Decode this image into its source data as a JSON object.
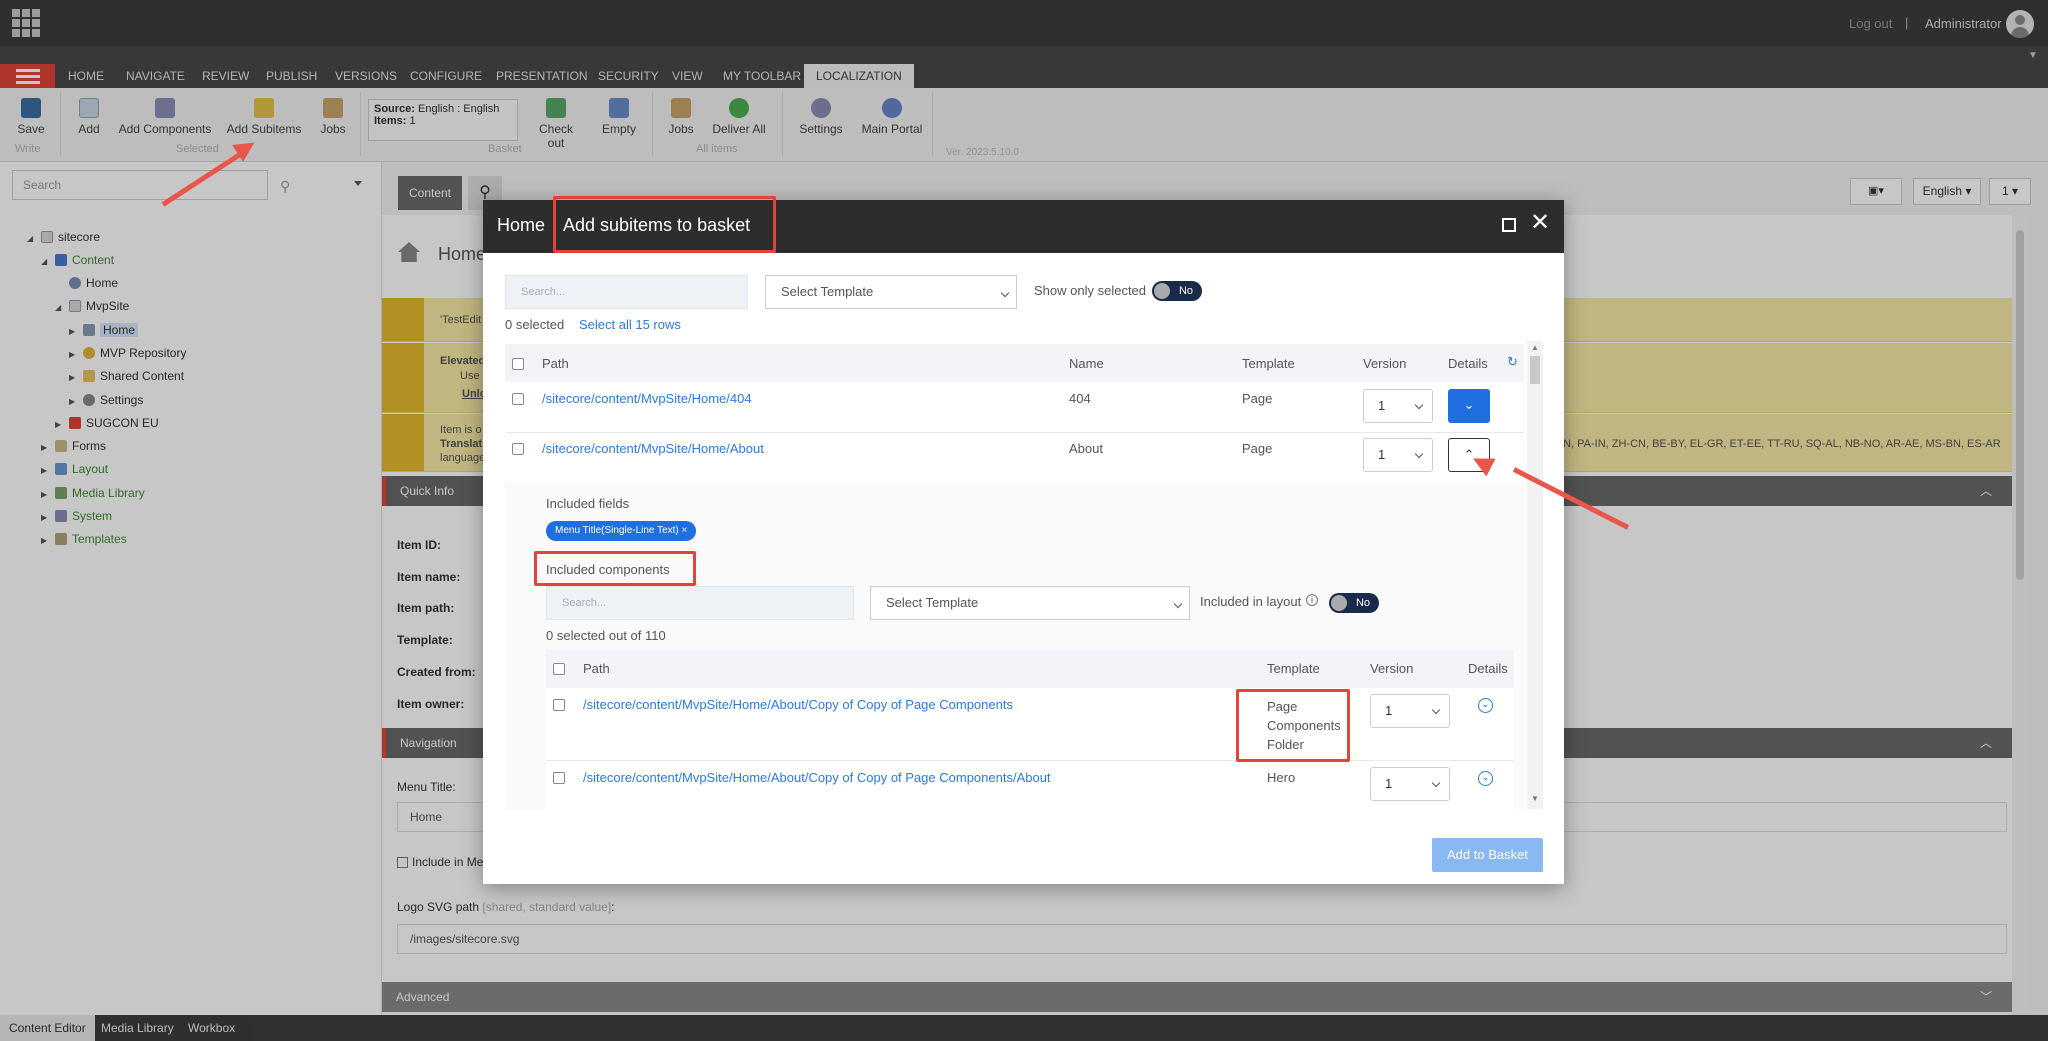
{
  "topbar": {
    "logout": "Log out",
    "separator": "|",
    "user": "Administrator"
  },
  "tabs": [
    "HOME",
    "NAVIGATE",
    "REVIEW",
    "PUBLISH",
    "VERSIONS",
    "CONFIGURE",
    "PRESENTATION",
    "SECURITY",
    "VIEW",
    "MY TOOLBAR",
    "LOCALIZATION"
  ],
  "ribbon": {
    "save": "Save",
    "add": "Add",
    "add_components": "Add Components",
    "add_subitems": "Add Subitems",
    "jobs1": "Jobs",
    "source_label": "Source:",
    "source_value": "English : English",
    "items_label": "Items:",
    "items_value": "1",
    "check_out": "Check out",
    "empty": "Empty",
    "jobs2": "Jobs",
    "deliver_all": "Deliver All",
    "settings": "Settings",
    "main_portal": "Main Portal",
    "group_write": "Write",
    "group_selected": "Selected",
    "group_basket": "Basket",
    "group_all": "All items",
    "version": "Ver. 2023.5.10.0"
  },
  "left": {
    "search_placeholder": "Search",
    "tree": [
      {
        "label": "sitecore",
        "green": false
      },
      {
        "label": "Content",
        "green": true
      },
      {
        "label": "Home",
        "green": false
      },
      {
        "label": "MvpSite",
        "green": false
      },
      {
        "label": "Home",
        "green": false
      },
      {
        "label": "MVP Repository",
        "green": false
      },
      {
        "label": "Shared Content",
        "green": false
      },
      {
        "label": "Settings",
        "green": false
      },
      {
        "label": "SUGCON EU",
        "green": false
      },
      {
        "label": "Forms",
        "green": false
      },
      {
        "label": "Layout",
        "green": true
      },
      {
        "label": "Media Library",
        "green": true
      },
      {
        "label": "System",
        "green": true
      },
      {
        "label": "Templates",
        "green": true
      }
    ]
  },
  "editor": {
    "content_tab": "Content",
    "language": "English",
    "version": "1",
    "page_title": "Home",
    "warn1": "'TestEdit",
    "warn2_title": "Elevated",
    "warn2_line": "Use",
    "warn2_link": "Unlo",
    "warn3_line1": "Item is o",
    "warn3_line2": "Translat",
    "warn3_line3": "language",
    "warn3_langs": "IN, PA-IN, ZH-CN, BE-BY, EL-GR, ET-EE, TT-RU, SQ-AL, NB-NO, AR-AE, MS-BN, ES-AR",
    "quick_info": "Quick Info",
    "labels": [
      "Item ID:",
      "Item name:",
      "Item path:",
      "Template:",
      "Created from:",
      "Item owner:"
    ],
    "navigation": "Navigation",
    "menu_title_label": "Menu Title:",
    "menu_title_value": "Home",
    "include_in_menu": "Include in Men",
    "logo_label": "Logo SVG path",
    "logo_meta": "[shared, standard value]",
    "logo_colon": ":",
    "logo_value": "/images/sitecore.svg",
    "advanced": "Advanced"
  },
  "bottom": [
    "Content Editor",
    "Media Library",
    "Workbox"
  ],
  "modal": {
    "title_home": "Home",
    "title": "Add subitems to basket",
    "search_placeholder": "Search...",
    "template_select": "Select Template",
    "show_only_selected": "Show only selected",
    "toggle_no": "No",
    "selected_count": "0 selected",
    "select_all": "Select all 15 rows",
    "columns": {
      "path": "Path",
      "name": "Name",
      "template": "Template",
      "version": "Version",
      "details": "Details"
    },
    "rows": [
      {
        "path": "/sitecore/content/MvpSite/Home/404",
        "name": "404",
        "template": "Page",
        "version": "1"
      },
      {
        "path": "/sitecore/content/MvpSite/Home/About",
        "name": "About",
        "template": "Page",
        "version": "1"
      }
    ],
    "included_fields": "Included fields",
    "chip": "Menu Title(Single-Line Text) ×",
    "included_components": "Included components",
    "comp_search_placeholder": "Search...",
    "comp_template_select": "Select Template",
    "included_in_layout": "Included in layout",
    "comp_toggle_no": "No",
    "comp_selected": "0 selected out of 110",
    "comp_columns": {
      "path": "Path",
      "template": "Template",
      "version": "Version",
      "details": "Details"
    },
    "comp_rows": [
      {
        "path": "/sitecore/content/MvpSite/Home/About/Copy of Copy of Page Components",
        "template_lines": [
          "Page",
          "Components",
          "Folder"
        ],
        "version": "1"
      },
      {
        "path": "/sitecore/content/MvpSite/Home/About/Copy of Copy of Page Components/About",
        "template_lines": [
          "Hero"
        ],
        "version": "1"
      }
    ],
    "add_to_basket": "Add to Basket"
  }
}
